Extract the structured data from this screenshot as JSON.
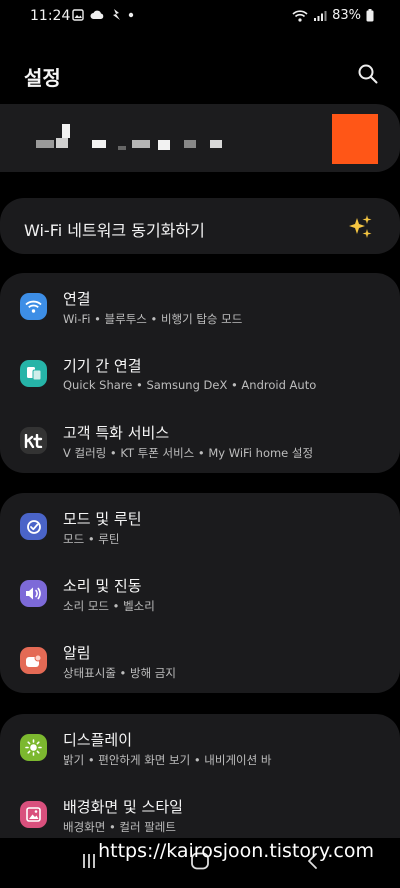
{
  "status": {
    "time": "11:24",
    "battery": "83%"
  },
  "header": {
    "title": "설정"
  },
  "sync": {
    "label": "Wi-Fi 네트워크 동기화하기"
  },
  "group1": [
    {
      "title": "연결",
      "subtitle": "Wi-Fi • 블루투스 • 비행기 탑승 모드",
      "icon": "wifi-icon",
      "color": "#3d8ee6"
    },
    {
      "title": "기기 간 연결",
      "subtitle": "Quick Share • Samsung DeX • Android Auto",
      "icon": "devices-icon",
      "color": "#26b4a8"
    },
    {
      "title": "고객 특화 서비스",
      "subtitle": "V 컬러링 • KT 투폰 서비스 • My WiFi home 설정",
      "icon": "kt-icon",
      "color": "#333333"
    }
  ],
  "group2": [
    {
      "title": "모드 및 루틴",
      "subtitle": "모드 • 루틴",
      "icon": "modes-icon",
      "color": "#4a64c8"
    },
    {
      "title": "소리 및 진동",
      "subtitle": "소리 모드 • 벨소리",
      "icon": "sound-icon",
      "color": "#7d6ad8"
    },
    {
      "title": "알림",
      "subtitle": "상태표시줄 • 방해 금지",
      "icon": "notification-icon",
      "color": "#e46a55"
    }
  ],
  "group3": [
    {
      "title": "디스플레이",
      "subtitle": "밝기 • 편안하게 화면 보기 • 내비게이션 바",
      "icon": "display-icon",
      "color": "#7cb82f"
    },
    {
      "title": "배경화면 및 스타일",
      "subtitle": "배경화면 • 컬러 팔레트",
      "icon": "wallpaper-icon",
      "color": "#d9507d"
    }
  ],
  "watermark": "https://kairosjoon.tistory.com"
}
